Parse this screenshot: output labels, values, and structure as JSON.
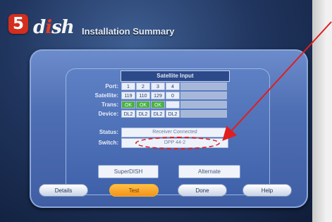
{
  "step_badge": "5",
  "logo": {
    "part1": "d",
    "dot": "i",
    "part2": "sh"
  },
  "screen_title": "Installation Summary",
  "satellite_input": {
    "header": "Satellite Input",
    "row_labels": [
      "Port:",
      "Satellite:",
      "Trans:",
      "Device:"
    ],
    "ports": [
      "1",
      "2",
      "3",
      "4"
    ],
    "satellites": [
      "119",
      "110",
      "129",
      "0"
    ],
    "trans": [
      "OK",
      "OK",
      "OK",
      ""
    ],
    "devices": [
      "DL2",
      "DL2",
      "DL2",
      "DL2"
    ]
  },
  "status": {
    "label": "Status:",
    "value": "Receiver Connected"
  },
  "switch": {
    "label": "Switch:",
    "value": "DPP 44-2"
  },
  "tabs": [
    {
      "label": "SuperDISH"
    },
    {
      "label": "Alternate"
    }
  ],
  "buttons": [
    {
      "label": "Details"
    },
    {
      "label": "Test"
    },
    {
      "label": "Done"
    },
    {
      "label": "Help"
    }
  ],
  "colors": {
    "badge": "#d42e1e",
    "annotation": "#e11d1d",
    "active_button": "#f3931b",
    "ok_cell": "#4fb049"
  }
}
